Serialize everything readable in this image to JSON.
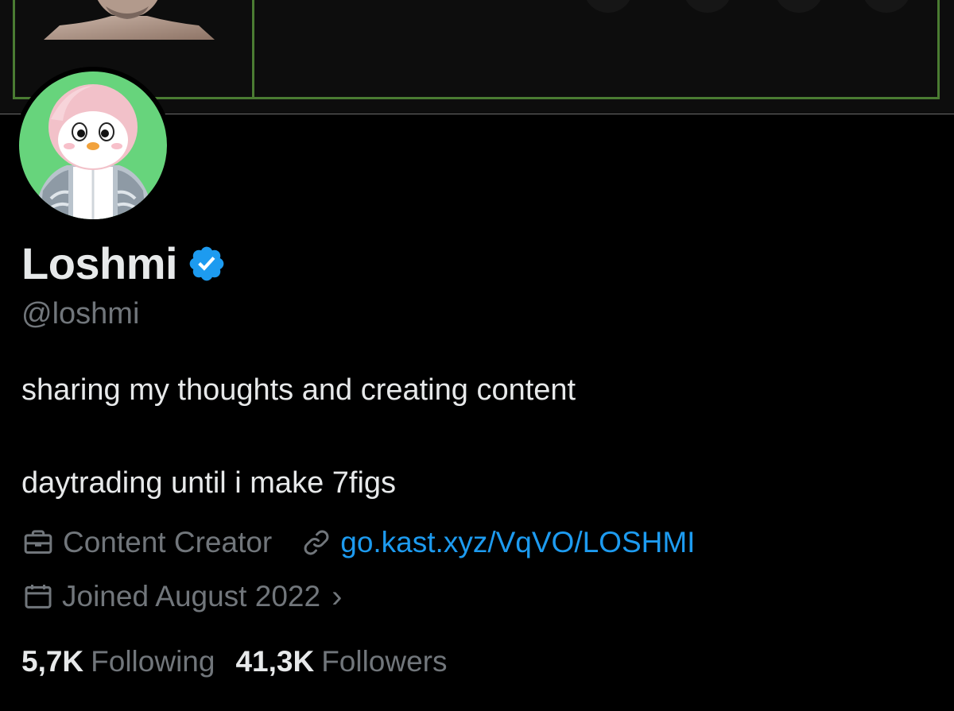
{
  "profile": {
    "display_name": "Loshmi",
    "handle": "@loshmi",
    "verified": true,
    "bio": [
      "sharing my thoughts and creating content",
      "daytrading until i make 7figs"
    ],
    "category": "Content Creator",
    "link": "go.kast.xyz/VqVO/LOSHMI",
    "joined": "Joined August 2022",
    "joined_chevron": "›",
    "following_count": "5,7K",
    "following_label": "Following",
    "followers_count": "41,3K",
    "followers_label": "Followers"
  },
  "icons": {
    "verified": "verified-badge-icon",
    "category": "briefcase-icon",
    "link": "link-icon",
    "joined": "calendar-icon"
  },
  "colors": {
    "background": "#000000",
    "text_primary": "#e7e9ea",
    "text_secondary": "#71767b",
    "link": "#1d9bf0",
    "verified": "#1d9bf0",
    "avatar_bg": "#67d47c",
    "banner_frame": "#4a7b32"
  }
}
